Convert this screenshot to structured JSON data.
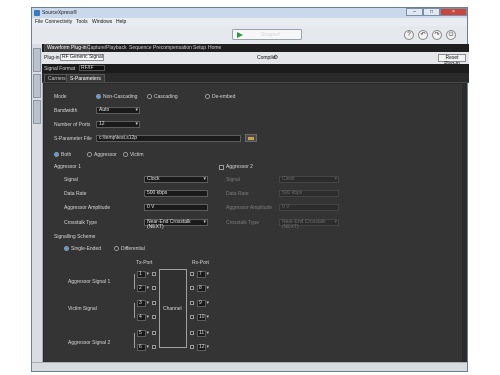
{
  "window": {
    "title": "SourceXpress®",
    "min": "–",
    "max": "□",
    "close": "×"
  },
  "menu": [
    "File",
    "Connectivity",
    "Tools",
    "Windows",
    "Help"
  ],
  "toolbar": {
    "run_label": "Stopped"
  },
  "top_tabs": [
    "Waveform Plug-in",
    "Capture/Playback",
    "Sequence",
    "Precompensation",
    "Setup",
    "Home"
  ],
  "plugin_bar": {
    "label": "Plug-in",
    "value": "RF Generic Signal",
    "compile": "Compile",
    "reset": "Reset Plug-in"
  },
  "signal_format": {
    "label": "Signal Format",
    "value": "RF/IF"
  },
  "sub_tabs": [
    "Carriers",
    "S-Parameters"
  ],
  "mode": {
    "label": "Mode",
    "options": [
      "Non-Cascading",
      "Cascading",
      "De-embed"
    ],
    "selected": "Non-Cascading"
  },
  "bandwidth": {
    "label": "Bandwidth",
    "value": "Auto"
  },
  "ports": {
    "label": "Number of Ports",
    "value": "12"
  },
  "sparam_file": {
    "label": "S-Parameter File",
    "value": "c:\\temp\\test.s12p"
  },
  "apply_to": {
    "options": [
      "Both",
      "Aggressor",
      "Victim"
    ],
    "selected": "Both"
  },
  "aggressor1": {
    "title": "Aggressor 1",
    "signal_label": "Signal",
    "signal_value": "Clock",
    "rate_label": "Data Rate",
    "rate_value": "500 kbps",
    "amp_label": "Aggressor Amplitude",
    "amp_value": "0 V",
    "xtalk_label": "Crosstalk Type",
    "xtalk_value": "Near-End Crosstalk (NEXT)"
  },
  "aggressor2": {
    "title": "Aggressor 2",
    "signal_label": "Signal",
    "signal_value": "Clock",
    "rate_label": "Data Rate",
    "rate_value": "500 kbps",
    "amp_label": "Aggressor Amplitude",
    "amp_value": "0 V",
    "xtalk_label": "Crosstalk Type",
    "xtalk_value": "Near-End Crosstalk (NEXT)"
  },
  "signalling": {
    "label": "Signalling Scheme",
    "options": [
      "Single-Ended",
      "Differential"
    ],
    "selected": "Single-Ended"
  },
  "diagram": {
    "tx_label": "Tx-Port",
    "rx_label": "Rx-Port",
    "channel_label": "Channel",
    "rows": [
      "Aggressor Signal 1",
      "Victim Signal",
      "Aggressor Signal 2"
    ],
    "tx_ports": [
      "1",
      "2",
      "3",
      "4",
      "5",
      "6"
    ],
    "rx_ports": [
      "7",
      "8",
      "9",
      "10",
      "11",
      "12"
    ]
  }
}
